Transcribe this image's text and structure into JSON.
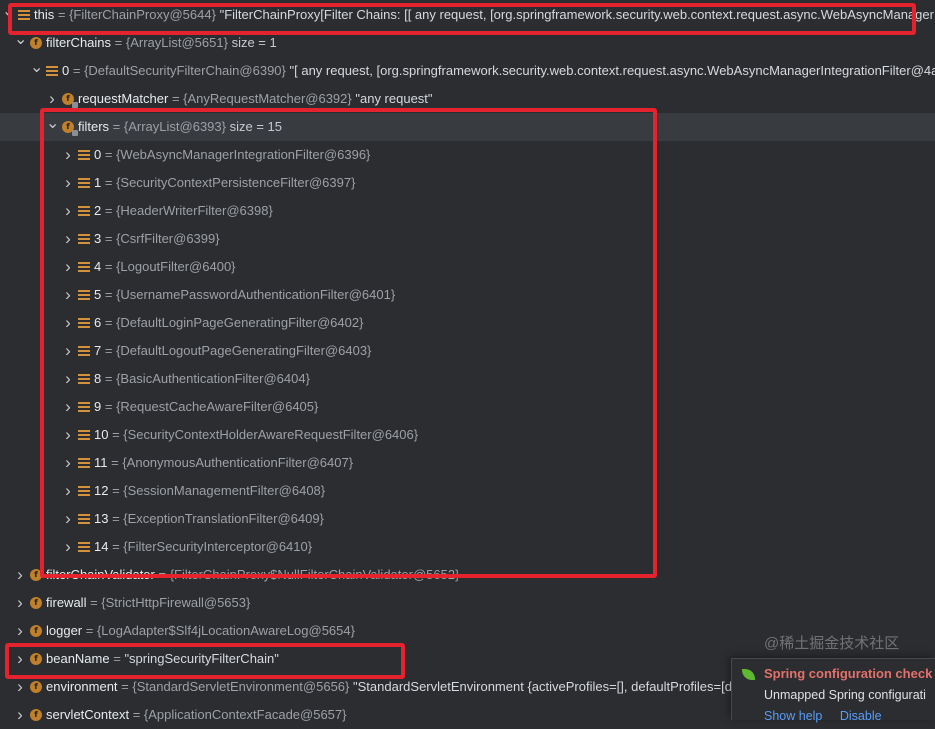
{
  "rows": [
    {
      "name": "this",
      "type": "{FilterChainProxy@5644}",
      "value": "\"FilterChainProxy[Filter Chains: [[ any request, [org.springframework.security.web.context.request.async.WebAsyncManagerInt"
    },
    {
      "name": "filterChains",
      "type": "{ArrayList@5651}",
      "meta": "size = 1"
    },
    {
      "name": "0",
      "type": "{DefaultSecurityFilterChain@6390}",
      "value": "\"[ any request, [org.springframework.security.web.context.request.async.WebAsyncManagerIntegrationFilter@4a"
    },
    {
      "name": "requestMatcher",
      "type": "{AnyRequestMatcher@6392}",
      "value": "\"any request\""
    },
    {
      "name": "filters",
      "type": "{ArrayList@6393}",
      "meta": "size = 15"
    },
    {
      "name": "0",
      "type": "{WebAsyncManagerIntegrationFilter@6396}"
    },
    {
      "name": "1",
      "type": "{SecurityContextPersistenceFilter@6397}"
    },
    {
      "name": "2",
      "type": "{HeaderWriterFilter@6398}"
    },
    {
      "name": "3",
      "type": "{CsrfFilter@6399}"
    },
    {
      "name": "4",
      "type": "{LogoutFilter@6400}"
    },
    {
      "name": "5",
      "type": "{UsernamePasswordAuthenticationFilter@6401}"
    },
    {
      "name": "6",
      "type": "{DefaultLoginPageGeneratingFilter@6402}"
    },
    {
      "name": "7",
      "type": "{DefaultLogoutPageGeneratingFilter@6403}"
    },
    {
      "name": "8",
      "type": "{BasicAuthenticationFilter@6404}"
    },
    {
      "name": "9",
      "type": "{RequestCacheAwareFilter@6405}"
    },
    {
      "name": "10",
      "type": "{SecurityContextHolderAwareRequestFilter@6406}"
    },
    {
      "name": "11",
      "type": "{AnonymousAuthenticationFilter@6407}"
    },
    {
      "name": "12",
      "type": "{SessionManagementFilter@6408}"
    },
    {
      "name": "13",
      "type": "{ExceptionTranslationFilter@6409}"
    },
    {
      "name": "14",
      "type": "{FilterSecurityInterceptor@6410}"
    },
    {
      "name": "filterChainValidator",
      "type": "{FilterChainProxy$NullFilterChainValidator@5652}"
    },
    {
      "name": "firewall",
      "type": "{StrictHttpFirewall@5653}"
    },
    {
      "name": "logger",
      "type": "{LogAdapter$Slf4jLocationAwareLog@5654}"
    },
    {
      "name": "beanName",
      "value": "\"springSecurityFilterChain\""
    },
    {
      "name": "environment",
      "type": "{StandardServletEnvironment@5656}",
      "value": "\"StandardServletEnvironment {activeProfiles=[], defaultProfiles=[d"
    },
    {
      "name": "servletContext",
      "type": "{ApplicationContextFacade@5657}"
    }
  ],
  "equals_sign": "=",
  "field_icon_letter": "f",
  "notification": {
    "title": "Spring configuration check",
    "body": "Unmapped Spring configurati",
    "links": [
      "Show help",
      "Disable"
    ]
  },
  "watermark": "@稀土掘金技术社区",
  "colors": {
    "background": "#2b2d30",
    "selected_row": "#383b3f",
    "highlight_box": "#e5232e",
    "field_icon": "#c07f2a",
    "list_icon": "#d2913a",
    "notification_title": "#e3716b",
    "link": "#589df6"
  }
}
